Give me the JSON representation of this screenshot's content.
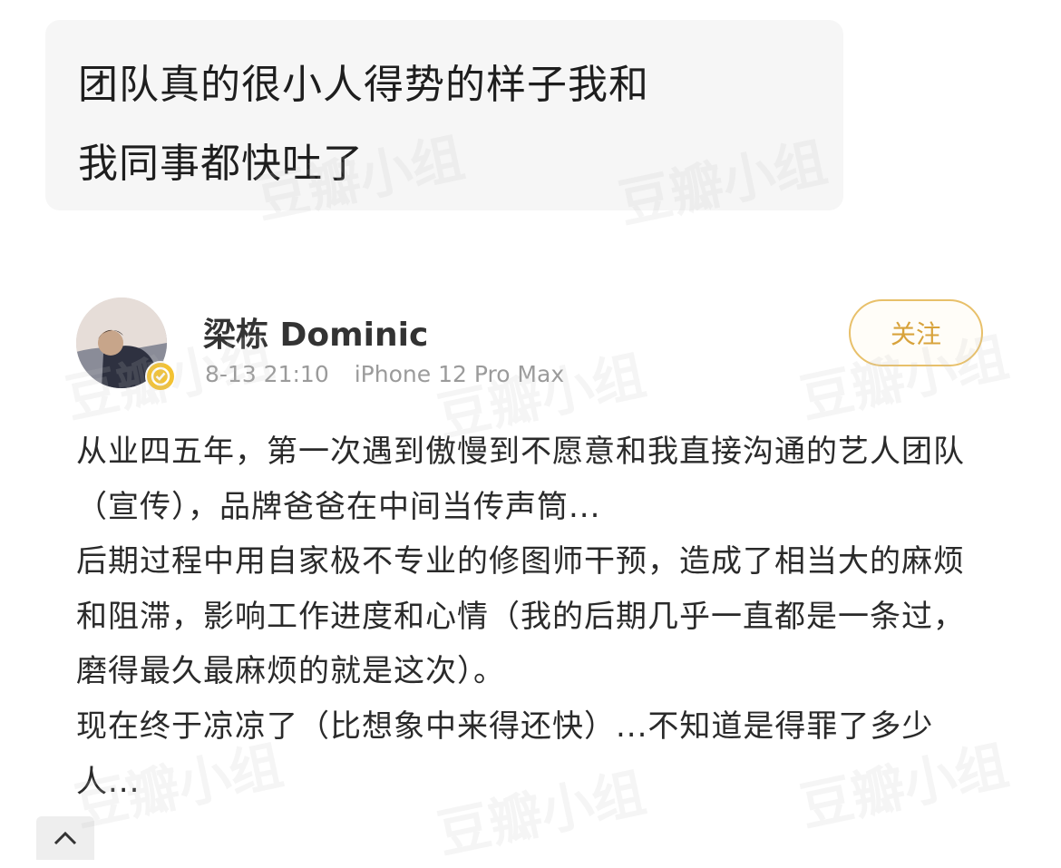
{
  "question": {
    "lines": [
      "团队真的很小人得势的样子我和",
      "我同事都快吐了"
    ]
  },
  "post": {
    "author": "梁栋 Dominic",
    "date": "8-13 21:10",
    "device": "iPhone 12 Pro Max",
    "follow_label": "关注",
    "paragraphs": [
      "从业四五年，第一次遇到傲慢到不愿意和我直接沟通的艺人团队（宣传），品牌爸爸在中间当传声筒...",
      "后期过程中用自家极不专业的修图师干预，造成了相当大的麻烦和阻滞，影响工作进度和心情（我的后期几乎一直都是一条过，磨得最久最麻烦的就是这次）。",
      "现在终于凉凉了（比想象中来得还快）...不知道是得罪了多少人..."
    ]
  },
  "watermark": "豆瓣小组",
  "colors": {
    "follow_accent": "#d8a33c",
    "verified_badge": "#f3c232",
    "bubble_bg": "#f6f6f6"
  },
  "icons": {
    "scroll_up": "chevron-up-icon",
    "verified": "verified-badge-icon"
  }
}
